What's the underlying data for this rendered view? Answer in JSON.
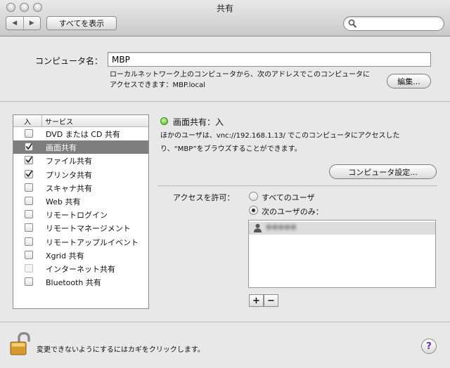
{
  "window": {
    "title": "共有"
  },
  "toolbar": {
    "back_glyph": "◀",
    "forward_glyph": "▶",
    "show_all_label": "すべてを表示",
    "search_placeholder": ""
  },
  "computer_name": {
    "label": "コンピュータ名：",
    "value": "MBP",
    "description_line1": "ローカルネットワーク上のコンピュータから、次のアドレスでこのコンピュータに",
    "description_line2": "アクセスできます：MBP.local",
    "edit_button": "編集..."
  },
  "services": {
    "header_on": "入",
    "header_service": "サービス",
    "items": [
      {
        "label": "DVD または CD 共有",
        "checked": false,
        "selected": false,
        "enabled": true
      },
      {
        "label": "画面共有",
        "checked": true,
        "selected": true,
        "enabled": true
      },
      {
        "label": "ファイル共有",
        "checked": true,
        "selected": false,
        "enabled": true
      },
      {
        "label": "プリンタ共有",
        "checked": true,
        "selected": false,
        "enabled": true
      },
      {
        "label": "スキャナ共有",
        "checked": false,
        "selected": false,
        "enabled": true
      },
      {
        "label": "Web 共有",
        "checked": false,
        "selected": false,
        "enabled": true
      },
      {
        "label": "リモートログイン",
        "checked": false,
        "selected": false,
        "enabled": true
      },
      {
        "label": "リモートマネージメント",
        "checked": false,
        "selected": false,
        "enabled": true
      },
      {
        "label": "リモートアップルイベント",
        "checked": false,
        "selected": false,
        "enabled": true
      },
      {
        "label": "Xgrid 共有",
        "checked": false,
        "selected": false,
        "enabled": true
      },
      {
        "label": "インターネット共有",
        "checked": false,
        "selected": false,
        "enabled": false
      },
      {
        "label": "Bluetooth 共有",
        "checked": false,
        "selected": false,
        "enabled": true
      }
    ]
  },
  "detail": {
    "status_color": "#4fb020",
    "status": "画面共有：入",
    "description_line1": "ほかのユーザは、vnc://192.168.1.13/ でこのコンピュータにアクセスした",
    "description_line2": "り、“MBP”をブラウズすることができます。",
    "computer_settings_button": "コンピュータ設定...",
    "access_label": "アクセスを許可：",
    "radio_all_users": "すべてのユーザ",
    "radio_only_users": "次のユーザのみ：",
    "selected_radio": "only",
    "users": [
      {
        "name": "●●●●●"
      }
    ],
    "add_button": "+",
    "remove_button": "−"
  },
  "footer": {
    "lock_text": "変更できないようにするにはカギをクリックします。",
    "help_glyph": "?"
  }
}
